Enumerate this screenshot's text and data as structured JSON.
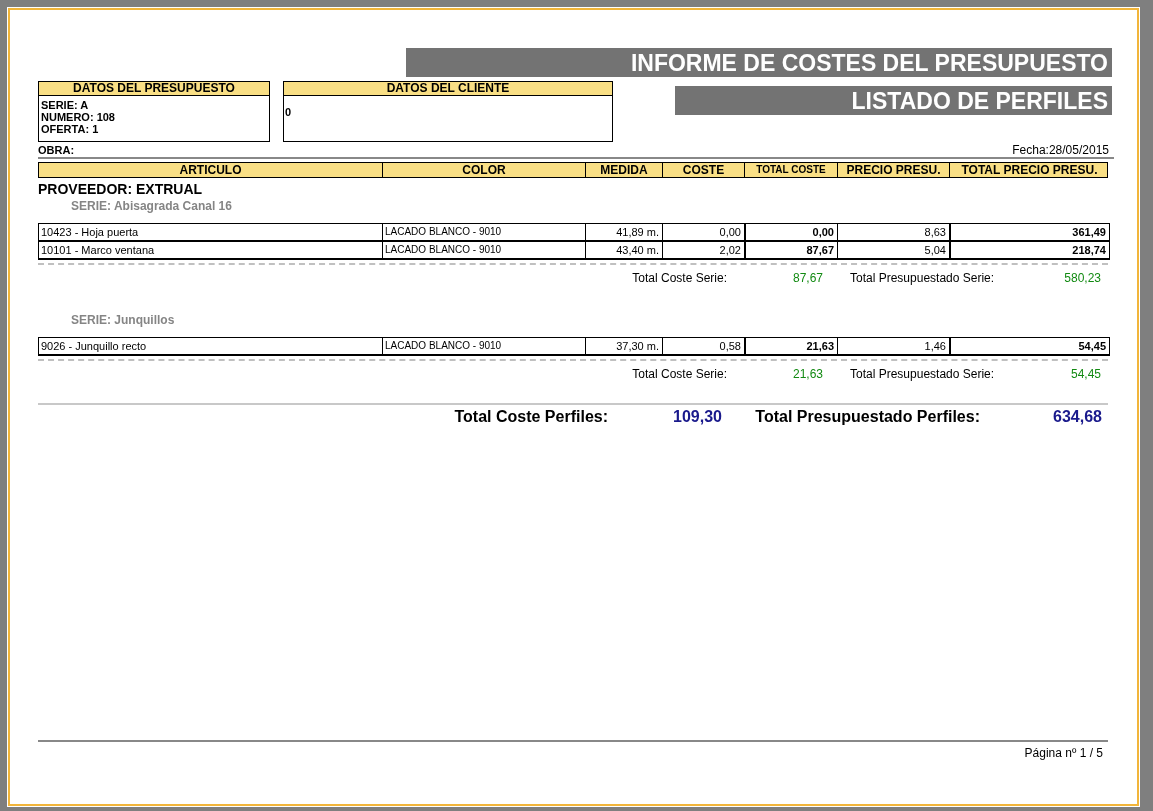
{
  "titles": [
    "INFORME DE COSTES DEL PRESUPUESTO",
    "LISTADO DE PERFILES"
  ],
  "budget_box": {
    "title": "DATOS DEL PRESUPUESTO",
    "lines": [
      {
        "label": "SERIE:",
        "value": "A"
      },
      {
        "label": "NUMERO:",
        "value": "108"
      },
      {
        "label": "OFERTA:",
        "value": "1"
      }
    ]
  },
  "client_box": {
    "title": "DATOS DEL CLIENTE",
    "value": "0"
  },
  "obra_label": "OBRA:",
  "date": "Fecha:28/05/2015",
  "columns": [
    "ARTICULO",
    "COLOR",
    "MEDIDA",
    "COSTE",
    "TOTAL COSTE",
    "PRECIO PRESU.",
    "TOTAL PRECIO PRESU."
  ],
  "provider": "PROVEEDOR: EXTRUAL",
  "series": [
    {
      "title": "SERIE: Abisagrada Canal 16",
      "rows": [
        [
          "10423 - Hoja puerta",
          "LACADO BLANCO - 9010",
          "41,89 m.",
          "0,00",
          "0,00",
          "8,63",
          "361,49"
        ],
        [
          "10101 - Marco ventana",
          "LACADO BLANCO - 9010",
          "43,40 m.",
          "2,02",
          "87,67",
          "5,04",
          "218,74"
        ]
      ],
      "cost_label": "Total Coste Serie:",
      "cost_total": "87,67",
      "budget_label": "Total Presupuestado Serie:",
      "budget_total": "580,23"
    },
    {
      "title": "SERIE: Junquillos",
      "rows": [
        [
          "9026 - Junquillo recto",
          "LACADO BLANCO - 9010",
          "37,30 m.",
          "0,58",
          "21,63",
          "1,46",
          "54,45"
        ]
      ],
      "cost_label": "Total Coste Serie:",
      "cost_total": "21,63",
      "budget_label": "Total Presupuestado Serie:",
      "budget_total": "54,45"
    }
  ],
  "grand": {
    "cost_label": "Total Coste Perfiles:",
    "cost_total": "109,30",
    "budget_label": "Total Presupuestado Perfiles:",
    "budget_total": "634,68"
  },
  "footer": "Página nº 1 / 5"
}
